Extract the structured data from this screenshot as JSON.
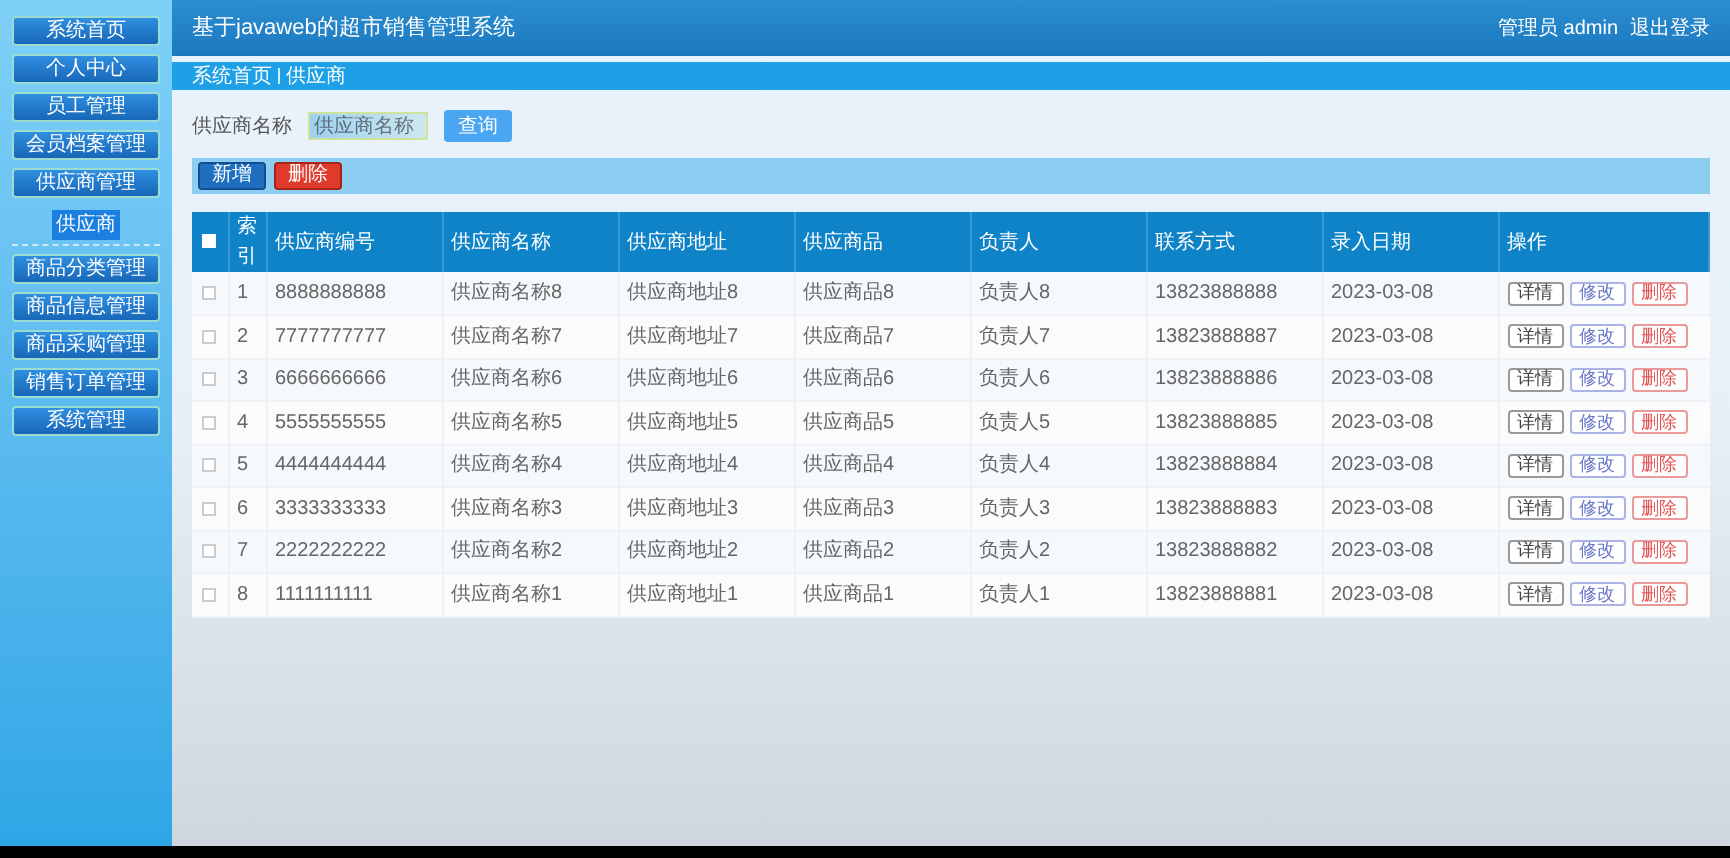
{
  "header": {
    "title": "基于javaweb的超市销售管理系统",
    "user": "管理员 admin",
    "logout": "退出登录"
  },
  "sidebar": {
    "items": [
      {
        "label": "系统首页"
      },
      {
        "label": "个人中心"
      },
      {
        "label": "员工管理"
      },
      {
        "label": "会员档案管理"
      },
      {
        "label": "供应商管理",
        "children": [
          {
            "label": "供应商",
            "selected": true
          }
        ]
      },
      {
        "label": "商品分类管理"
      },
      {
        "label": "商品信息管理"
      },
      {
        "label": "商品采购管理"
      },
      {
        "label": "销售订单管理"
      },
      {
        "label": "系统管理"
      }
    ]
  },
  "breadcrumb": [
    "系统首页",
    "供应商"
  ],
  "search": {
    "label": "供应商名称",
    "placeholder": "供应商名称",
    "button": "查询"
  },
  "actions": [
    "新增",
    "删除"
  ],
  "table": {
    "select_all_checked": false,
    "columns": [
      "索引",
      "供应商编号",
      "供应商名称",
      "供应商地址",
      "供应商品",
      "负责人",
      "联系方式",
      "录入日期",
      "操作"
    ],
    "rows": [
      {
        "checked": false,
        "cells": [
          "1",
          "8888888888",
          "供应商名称8",
          "供应商地址8",
          "供应商品8",
          "负责人8",
          "13823888888",
          "2023-03-08"
        ],
        "buttons": [
          "详情",
          "修改",
          "删除"
        ]
      },
      {
        "checked": false,
        "cells": [
          "2",
          "7777777777",
          "供应商名称7",
          "供应商地址7",
          "供应商品7",
          "负责人7",
          "13823888887",
          "2023-03-08"
        ],
        "buttons": [
          "详情",
          "修改",
          "删除"
        ]
      },
      {
        "checked": false,
        "cells": [
          "3",
          "6666666666",
          "供应商名称6",
          "供应商地址6",
          "供应商品6",
          "负责人6",
          "13823888886",
          "2023-03-08"
        ],
        "buttons": [
          "详情",
          "修改",
          "删除"
        ]
      },
      {
        "checked": false,
        "cells": [
          "4",
          "5555555555",
          "供应商名称5",
          "供应商地址5",
          "供应商品5",
          "负责人5",
          "13823888885",
          "2023-03-08"
        ],
        "buttons": [
          "详情",
          "修改",
          "删除"
        ]
      },
      {
        "checked": false,
        "cells": [
          "5",
          "4444444444",
          "供应商名称4",
          "供应商地址4",
          "供应商品4",
          "负责人4",
          "13823888884",
          "2023-03-08"
        ],
        "buttons": [
          "详情",
          "修改",
          "删除"
        ]
      },
      {
        "checked": false,
        "cells": [
          "6",
          "3333333333",
          "供应商名称3",
          "供应商地址3",
          "供应商品3",
          "负责人3",
          "13823888883",
          "2023-03-08"
        ],
        "buttons": [
          "详情",
          "修改",
          "删除"
        ]
      },
      {
        "checked": false,
        "cells": [
          "7",
          "2222222222",
          "供应商名称2",
          "供应商地址2",
          "供应商品2",
          "负责人2",
          "13823888882",
          "2023-03-08"
        ],
        "buttons": [
          "详情",
          "修改",
          "删除"
        ]
      },
      {
        "checked": false,
        "cells": [
          "8",
          "1111111111",
          "供应商名称1",
          "供应商地址1",
          "供应商品1",
          "负责人1",
          "13823888881",
          "2023-03-08"
        ],
        "buttons": [
          "详情",
          "修改",
          "删除"
        ]
      }
    ]
  }
}
